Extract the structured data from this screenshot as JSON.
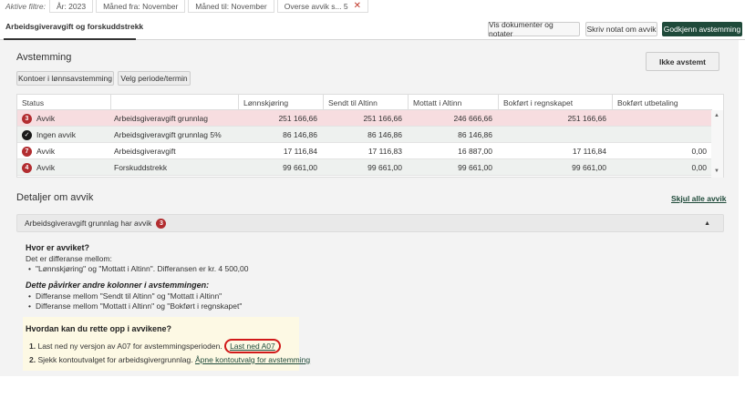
{
  "filters": {
    "label": "Aktive filtre:",
    "chips": [
      {
        "text": "År: 2023"
      },
      {
        "text": "Måned fra: November"
      },
      {
        "text": "Måned til: November"
      },
      {
        "text": "Overse avvik s...  5"
      }
    ]
  },
  "header": {
    "tab_title": "Arbeidsgiveravgift og forskuddstrekk",
    "btn_documents": "Vis dokumenter og notater",
    "btn_note": "Skriv notat om avvik",
    "btn_approve": "Godkjenn avstemming"
  },
  "avstemming": {
    "title": "Avstemming",
    "btn_accounts": "Kontoer i lønnsavstemming",
    "btn_period": "Velg periode/termin",
    "btn_not_reconciled": "Ikke avstemt"
  },
  "table": {
    "columns": [
      "Status",
      "",
      "Lønnskjøring",
      "Sendt til Altinn",
      "Mottatt i Altinn",
      "Bokført i regnskapet",
      "Bokført utbetaling"
    ],
    "rows": [
      {
        "badge": "3",
        "status": "Avvik",
        "name": "Arbeidsgiveravgift grunnlag",
        "lonn": "251 166,66",
        "sendt": "251 166,66",
        "mottatt": "246 666,66",
        "bokfort": "251 166,66",
        "utbet": ""
      },
      {
        "badge": "✓",
        "status": "Ingen avvik",
        "name": "Arbeidsgiveravgift grunnlag 5%",
        "lonn": "86 146,86",
        "sendt": "86 146,86",
        "mottatt": "86 146,86",
        "bokfort": "",
        "utbet": ""
      },
      {
        "badge": "7",
        "status": "Avvik",
        "name": "Arbeidsgiveravgift",
        "lonn": "17 116,84",
        "sendt": "17 116,83",
        "mottatt": "16 887,00",
        "bokfort": "17 116,84",
        "utbet": "0,00"
      },
      {
        "badge": "4",
        "status": "Avvik",
        "name": "Forskuddstrekk",
        "lonn": "99 661,00",
        "sendt": "99 661,00",
        "mottatt": "99 661,00",
        "bokfort": "99 661,00",
        "utbet": "0,00"
      }
    ]
  },
  "details": {
    "title": "Detaljer om avvik",
    "hide_all": "Skjul alle avvik",
    "accordion_title": "Arbeidsgiveravgift grunnlag har avvik",
    "accordion_badge": "3",
    "where_title": "Hvor er avviket?",
    "where_text": "Det er differanse mellom:",
    "where_item": "\"Lønnskjøring\" og \"Mottatt i Altinn\". Differansen er kr. 4 500,00",
    "affects_title": "Dette påvirker andre kolonner i avstemmingen:",
    "affects_items": [
      "Differanse mellom \"Sendt til Altinn\" og \"Mottatt i Altinn\"",
      "Differanse mellom \"Mottatt i Altinn\" og \"Bokført i regnskapet\""
    ],
    "fix_title": "Hvordan kan du rette opp i avvikene?",
    "fix_1_num": "1.",
    "fix_1_text": "Last ned ny versjon av A07 for avstemmingsperioden.",
    "fix_1_link": "Last ned A07",
    "fix_2_num": "2.",
    "fix_2_text": "Sjekk kontoutvalget for arbeidsgivergrunnlag.",
    "fix_2_link": "Åpne kontoutvalg for avstemming"
  },
  "colors": {
    "accent": "#1f4a3a",
    "error": "#b22d30",
    "highlight_row": "#f7dde0",
    "help_bg": "#fdf9e4"
  }
}
